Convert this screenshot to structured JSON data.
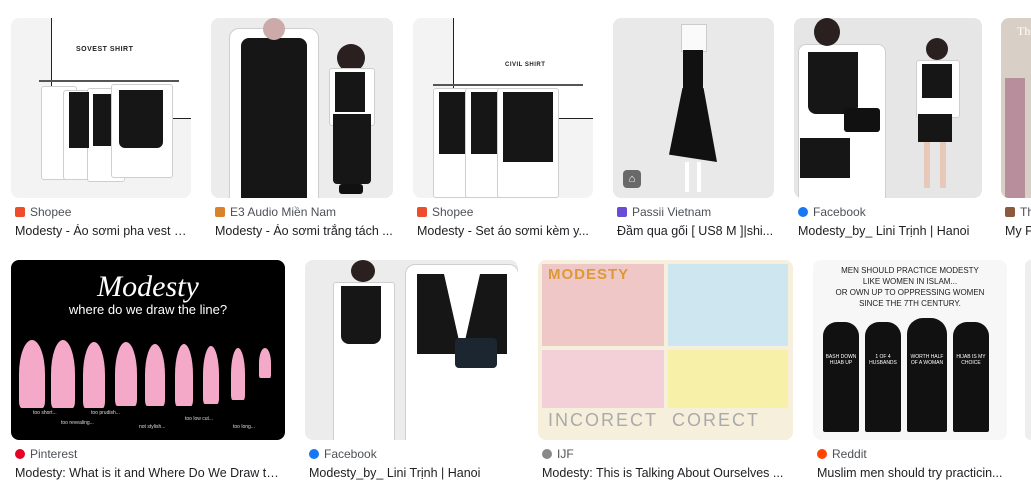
{
  "results": [
    {
      "source": "Shopee",
      "title": "Modesty - Áo sơmi pha vest b...",
      "image_text": "SOVEST SHIRT",
      "favicon_color": "#ee4d2d"
    },
    {
      "source": "E3 Audio Miền Nam",
      "title": "Modesty - Áo sơmi trắng tách ...",
      "image_text": "",
      "favicon_color": "#d9822b"
    },
    {
      "source": "Shopee",
      "title": "Modesty - Set áo sơmi kèm y...",
      "image_text": "CIVIL SHIRT",
      "favicon_color": "#ee4d2d"
    },
    {
      "source": "Passii Vietnam",
      "title": "Đầm qua gối [ US8 M ]|shi...",
      "image_text": "",
      "favicon_color": "#6a4bd6"
    },
    {
      "source": "Facebook",
      "title": "Modesty_by_ Lini Trịnh | Hanoi",
      "image_text": "",
      "favicon_color": "#1877f2"
    },
    {
      "source": "Th",
      "title": "My P",
      "image_text": "The",
      "favicon_color": "#8b5a3c"
    },
    {
      "source": "Pinterest",
      "title": "Modesty: What is it and Where Do We Draw the...",
      "image_title": "Modesty",
      "image_subtitle": "where do we draw the line?",
      "image_captions": [
        "too short...",
        "too prudish...",
        "too revealing...",
        "not stylish...",
        "too low cut...",
        "too long..."
      ],
      "favicon_color": "#e60023"
    },
    {
      "source": "Facebook",
      "title": "Modesty_by_ Lini Trịnh | Hanoi",
      "image_text": "",
      "favicon_color": "#1877f2"
    },
    {
      "source": "IJF",
      "title": "Modesty: This is Talking About Ourselves ...",
      "image_title": "MODESTY",
      "image_words": [
        "INCORECT",
        "CORECT"
      ],
      "favicon_color": "#888888"
    },
    {
      "source": "Reddit",
      "title": "Muslim men should try practicin...",
      "image_headline": [
        "MEN SHOULD PRACTICE MODESTY",
        "LIKE WOMEN IN ISLAM...",
        "OR OWN UP TO OPPRESSING WOMEN",
        "SINCE THE 7TH CENTURY."
      ],
      "image_signs": [
        "BASH DOWN HIJAB UP",
        "1 OF 4 HUSBANDS",
        "WORTH HALF OF A WOMAN",
        "HIJAB IS MY CHOICE"
      ],
      "favicon_color": "#ff4500"
    }
  ]
}
